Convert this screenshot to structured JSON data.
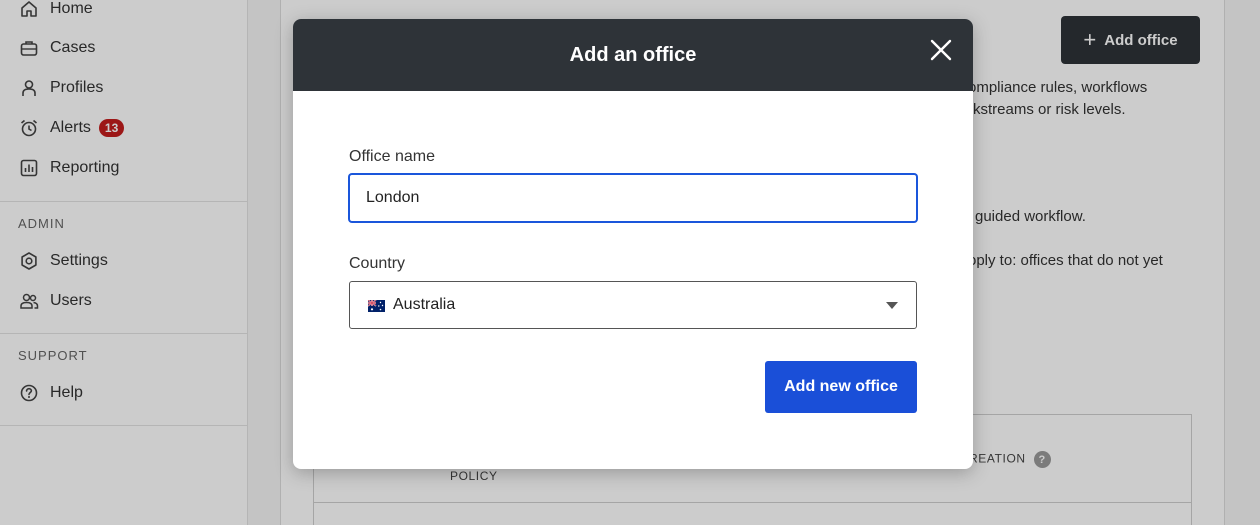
{
  "sidebar": {
    "items": [
      {
        "label": "Home",
        "icon": "home-icon"
      },
      {
        "label": "Cases",
        "icon": "briefcase-icon"
      },
      {
        "label": "Profiles",
        "icon": "person-icon"
      },
      {
        "label": "Alerts",
        "icon": "alarm-clock-icon",
        "badge": "13"
      },
      {
        "label": "Reporting",
        "icon": "bar-chart-icon"
      }
    ],
    "admin_label": "ADMIN",
    "admin_items": [
      {
        "label": "Settings",
        "icon": "gear-icon"
      },
      {
        "label": "Users",
        "icon": "users-icon"
      }
    ],
    "support_label": "SUPPORT",
    "support_items": [
      {
        "label": "Help",
        "icon": "question-circle-icon"
      }
    ]
  },
  "main": {
    "add_office_label": "Add office",
    "partial_text": [
      "ompliance rules, workflows",
      "rkstreams or risk levels.",
      "guided workflow.",
      "oply to: offices that do not yet"
    ],
    "table": {
      "header_policy": "POLICY",
      "header_creation": "REATION",
      "help_glyph": "?"
    }
  },
  "modal": {
    "title": "Add an office",
    "office_name_label": "Office name",
    "office_name_value": "London",
    "country_label": "Country",
    "country_value": "Australia",
    "submit_label": "Add new office"
  },
  "colors": {
    "header_dark": "#2e3338",
    "primary_blue": "#1a4fd8",
    "badge_red": "#c41d1d"
  }
}
